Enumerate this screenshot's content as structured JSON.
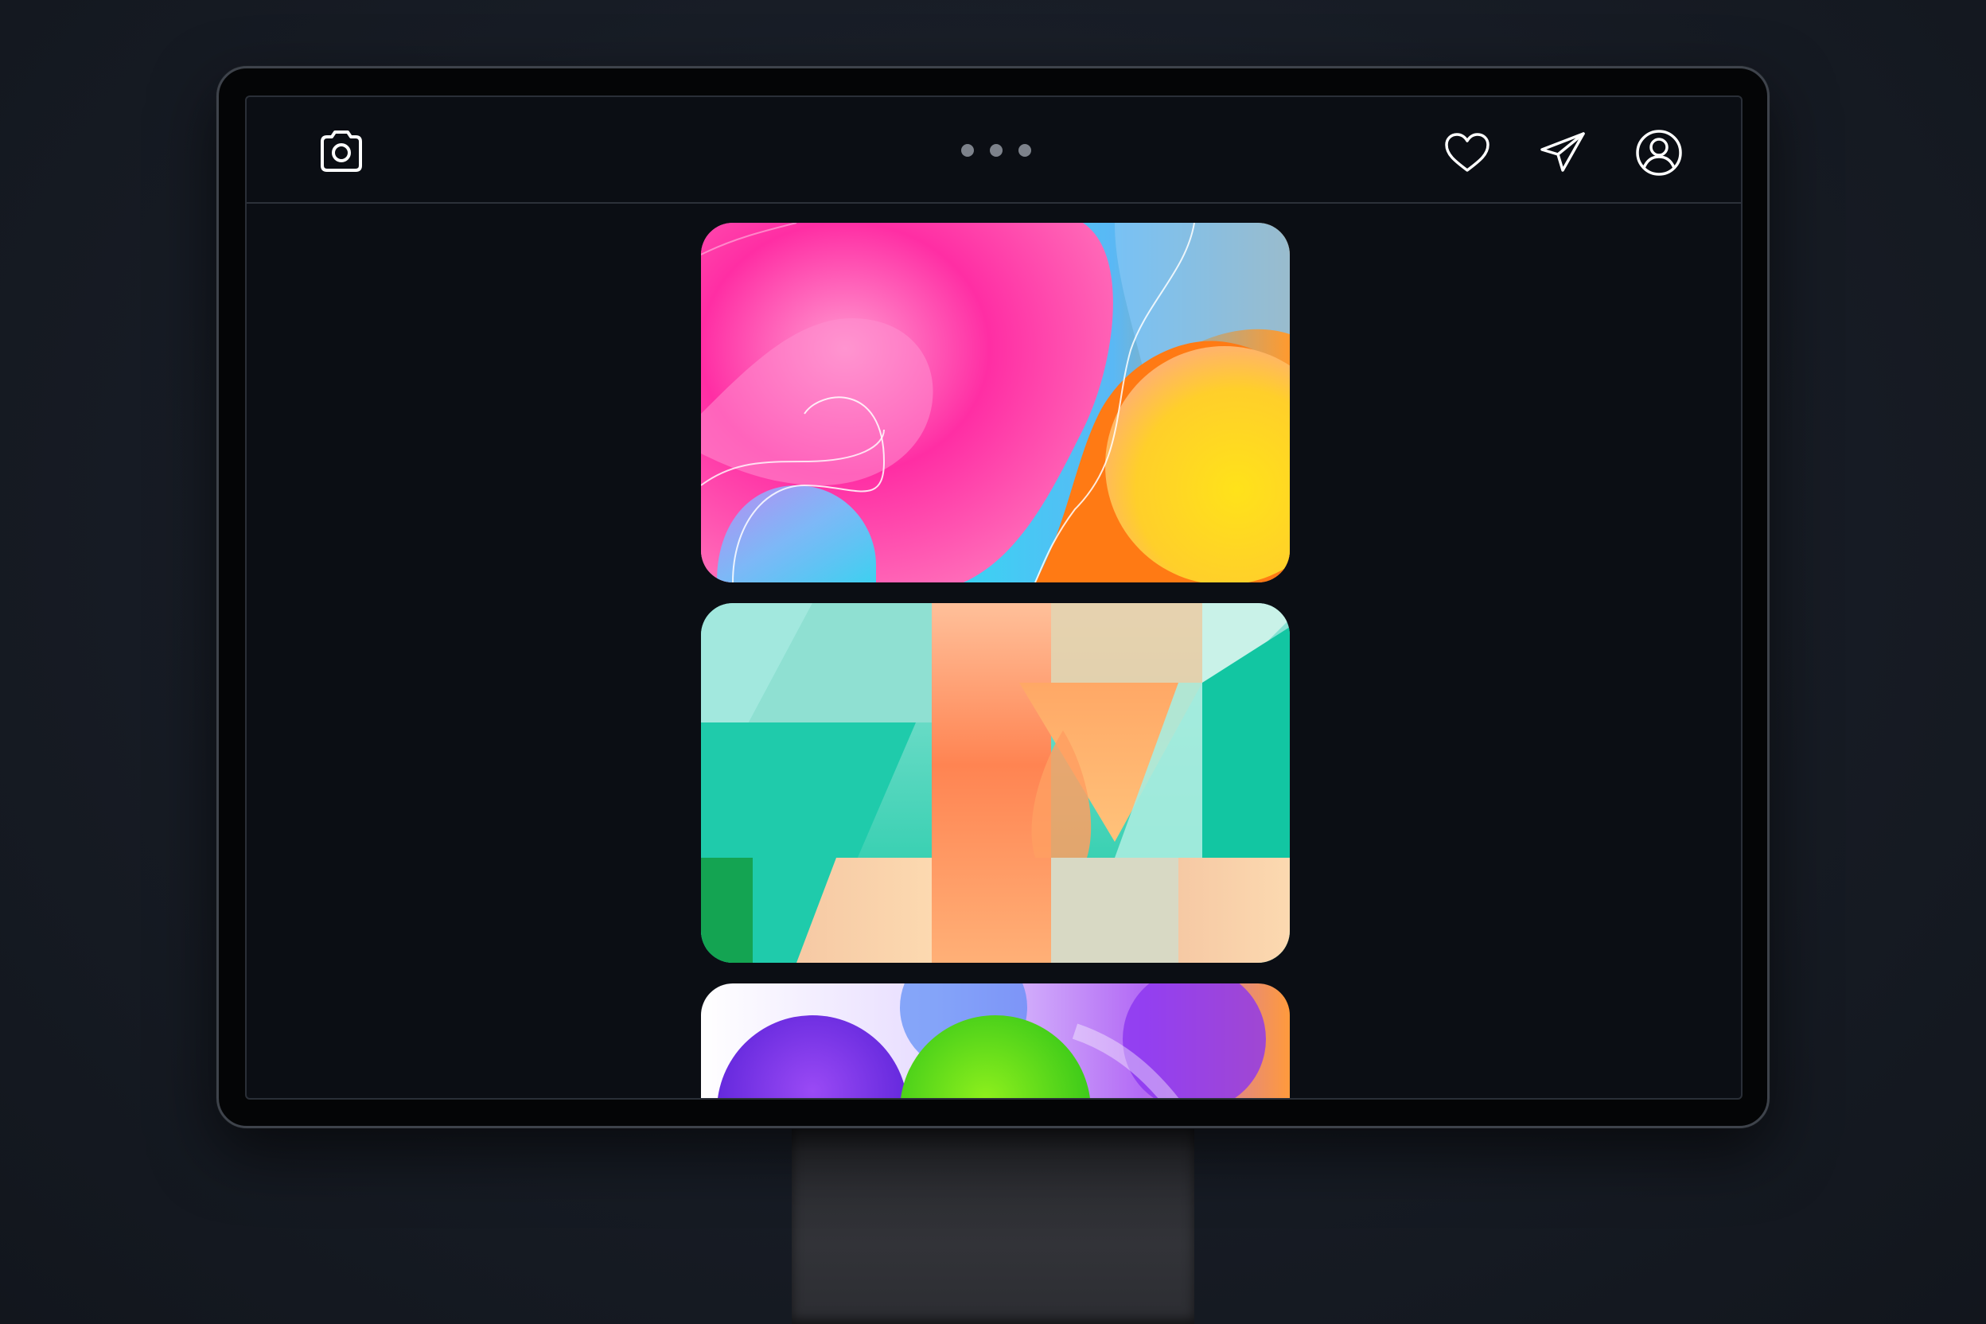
{
  "app": {
    "header": {
      "camera_icon": "camera-icon",
      "menu_icon": "more-dots-icon",
      "actions": [
        {
          "icon": "heart-icon"
        },
        {
          "icon": "paper-plane-icon"
        },
        {
          "icon": "profile-icon"
        }
      ]
    },
    "feed": {
      "posts": [
        {
          "theme": "pink-cyan-yellow-fluid",
          "colors": [
            "#ff2ba0",
            "#2fd9f0",
            "#ffd21a",
            "#ff7a1a"
          ]
        },
        {
          "theme": "teal-orange-geometric",
          "colors": [
            "#1fc9a6",
            "#ff8a4c",
            "#ffc08a",
            "#9be8d8"
          ]
        },
        {
          "theme": "purple-green-bubbles",
          "colors": [
            "#7b2cf0",
            "#7be01a",
            "#ff9a3c",
            "#ffffff"
          ]
        }
      ]
    }
  },
  "colors": {
    "background": "#171c25",
    "screen": "#0b0e14",
    "icon_stroke": "#ffffff",
    "divider": "#2c3139"
  }
}
